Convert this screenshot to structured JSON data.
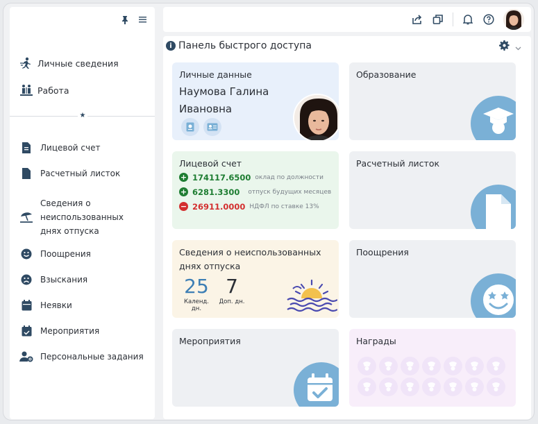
{
  "sidebar": {
    "main_items": [
      {
        "label": "Личные сведения",
        "icon": "person-run-icon"
      },
      {
        "label": "Работа",
        "icon": "work-icon"
      }
    ],
    "items": [
      {
        "label": "Лицевой счет",
        "icon": "document-icon"
      },
      {
        "label": "Расчетный листок",
        "icon": "file-icon"
      },
      {
        "label": "Сведения о неиспользованных днях отпуска",
        "icon": "beach-umbrella-icon"
      },
      {
        "label": "Поощрения",
        "icon": "smile-icon"
      },
      {
        "label": "Взыскания",
        "icon": "sad-face-icon"
      },
      {
        "label": "Неявки",
        "icon": "calendar-icon"
      },
      {
        "label": "Мероприятия",
        "icon": "calendar-check-icon"
      },
      {
        "label": "Персональные задания",
        "icon": "user-gear-icon"
      }
    ]
  },
  "panel": {
    "title": "Панель быстрого доступа"
  },
  "cards": {
    "personal": {
      "title": "Личные данные",
      "name_line1": "Наумова Галина",
      "name_line2": "Ивановна"
    },
    "education": {
      "title": "Образование"
    },
    "account": {
      "title": "Лицевой счет",
      "rows": [
        {
          "amount": "174117.6500",
          "label": "оклад по должности",
          "sign": "+",
          "color": "#1e7d32"
        },
        {
          "amount": "6281.3300",
          "label": "отпуск будущих месяцев",
          "sign": "+",
          "color": "#1e7d32"
        },
        {
          "amount": "26911.0000",
          "label": "НДФЛ по ставке 13%",
          "sign": "−",
          "color": "#d32f2f"
        }
      ]
    },
    "payslip": {
      "title": "Расчетный листок"
    },
    "vacation": {
      "title": "Сведения о неиспользованных днях отпуска",
      "cal_days": "25",
      "cal_label": "Календ. дн.",
      "extra_days": "7",
      "extra_label": "Доп. дн."
    },
    "rewards_card": {
      "title": "Поощрения"
    },
    "events": {
      "title": "Мероприятия"
    },
    "awards": {
      "title": "Награды"
    }
  },
  "colors": {
    "accent": "#2f4a63",
    "icon_circle": "#7ab0d6",
    "personal_bg": "#e8f0fb",
    "account_bg": "#eaf6ec",
    "vacation_bg": "#fbf4e6",
    "neutral_bg": "#eef0f3",
    "awards_bg": "#f8eefa"
  }
}
